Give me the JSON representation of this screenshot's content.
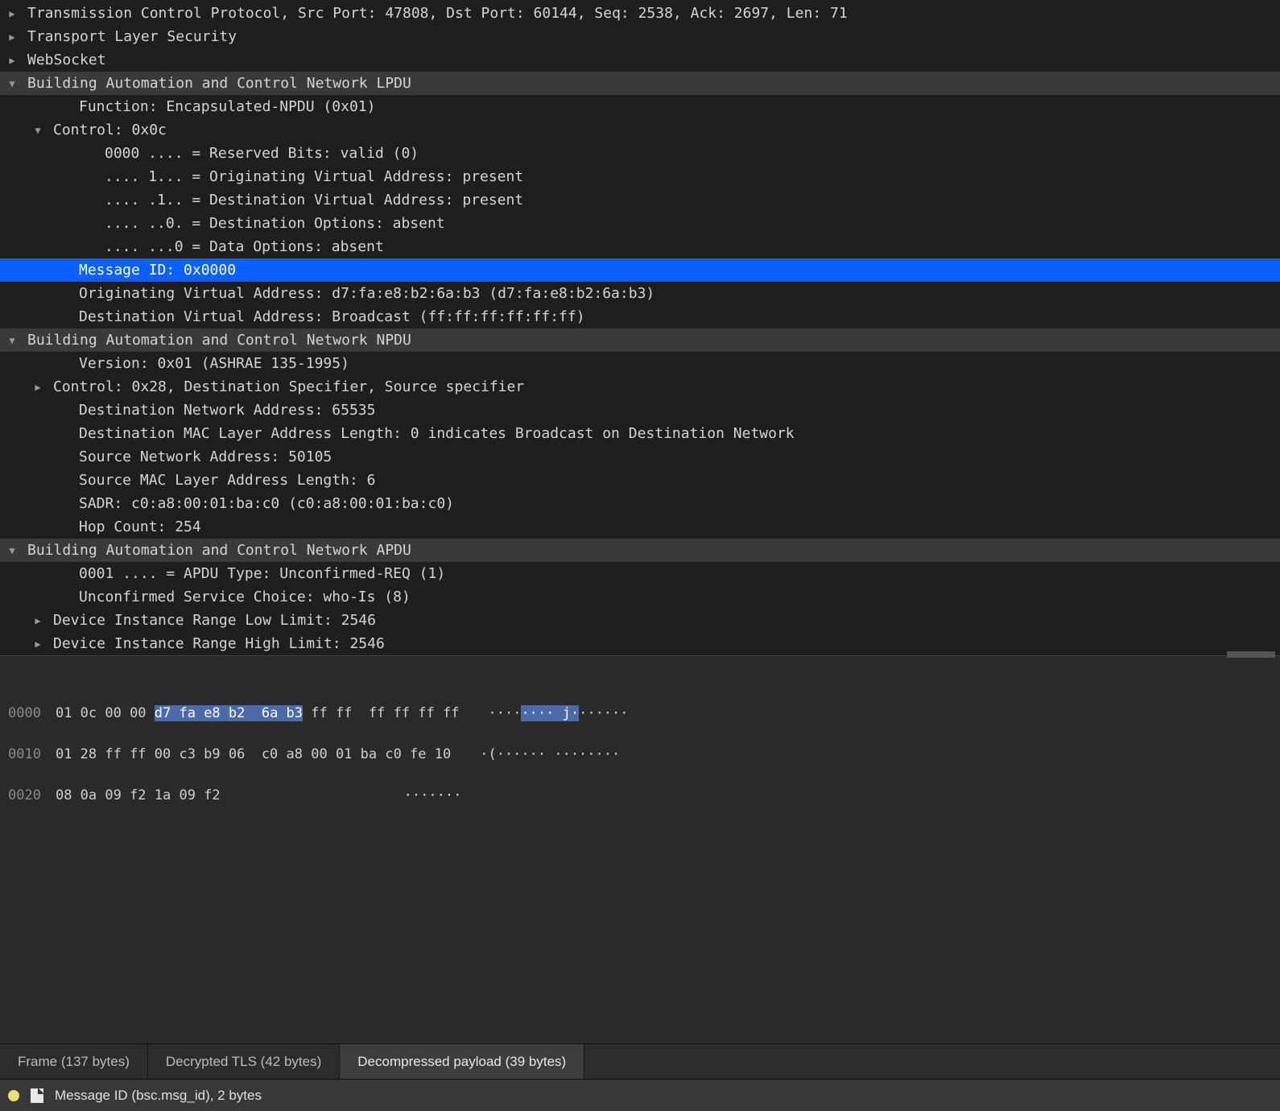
{
  "tree": {
    "tcp": "Transmission Control Protocol, Src Port: 47808, Dst Port: 60144, Seq: 2538, Ack: 2697, Len: 71",
    "tls": "Transport Layer Security",
    "ws": "WebSocket",
    "lpdu": {
      "title": "Building Automation and Control Network LPDU",
      "function": "Function: Encapsulated-NPDU (0x01)",
      "control": "Control: 0x0c",
      "bits": {
        "reserved": "0000 .... = Reserved Bits: valid (0)",
        "ova": ".... 1... = Originating Virtual Address: present",
        "dva": ".... .1.. = Destination Virtual Address: present",
        "dopt": ".... ..0. = Destination Options: absent",
        "dataopt": ".... ...0 = Data Options: absent"
      },
      "msgid": "Message ID: 0x0000",
      "origaddr": "Originating Virtual Address: d7:fa:e8:b2:6a:b3 (d7:fa:e8:b2:6a:b3)",
      "destaddr": "Destination Virtual Address: Broadcast (ff:ff:ff:ff:ff:ff)"
    },
    "npdu": {
      "title": "Building Automation and Control Network NPDU",
      "version": "Version: 0x01 (ASHRAE 135-1995)",
      "control": "Control: 0x28, Destination Specifier, Source specifier",
      "dnet": "Destination Network Address: 65535",
      "dlen": "Destination MAC Layer Address Length: 0 indicates Broadcast on Destination Network",
      "snet": "Source Network Address: 50105",
      "slen": "Source MAC Layer Address Length: 6",
      "sadr": "SADR: c0:a8:00:01:ba:c0 (c0:a8:00:01:ba:c0)",
      "hop": "Hop Count: 254"
    },
    "apdu": {
      "title": "Building Automation and Control Network APDU",
      "type": "0001 .... = APDU Type: Unconfirmed-REQ (1)",
      "service": "Unconfirmed Service Choice: who-Is (8)",
      "low": "Device Instance Range Low Limit: 2546",
      "high": "Device Instance Range High Limit: 2546"
    }
  },
  "hex": {
    "r0_off": "0000",
    "r0_pre": "01 0c 00 00 ",
    "r0_hl": "d7 fa e8 b2  6a b3",
    "r0_post": " ff ff  ff ff ff ff",
    "r0_ascii_pre": "····",
    "r0_ascii_hl": "···· j·",
    "r0_ascii_post": "······",
    "r1_off": "0010",
    "r1_hex": "01 28 ff ff 00 c3 b9 06  c0 a8 00 01 ba c0 fe 10",
    "r1_ascii": "·(······ ········",
    "r2_off": "0020",
    "r2_hex": "08 0a 09 f2 1a 09 f2",
    "r2_ascii": "·······"
  },
  "tabs": {
    "frame": "Frame (137 bytes)",
    "tls": "Decrypted TLS (42 bytes)",
    "payload": "Decompressed payload (39 bytes)"
  },
  "status": {
    "text": "Message ID (bsc.msg_id), 2 bytes"
  }
}
